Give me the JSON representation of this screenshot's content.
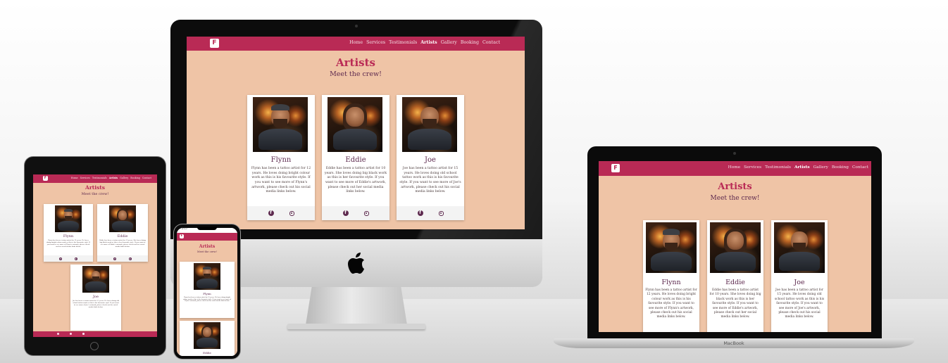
{
  "site": {
    "logo": "F",
    "nav": [
      {
        "label": "Home",
        "active": false
      },
      {
        "label": "Services",
        "active": false
      },
      {
        "label": "Testimonials",
        "active": false
      },
      {
        "label": "Artists",
        "active": true
      },
      {
        "label": "Gallery",
        "active": false
      },
      {
        "label": "Booking",
        "active": false
      },
      {
        "label": "Contact",
        "active": false
      }
    ],
    "title": "Artists",
    "subtitle": "Meet the crew!",
    "artists": [
      {
        "name": "Flynn",
        "desc": "Flynn has been a tattoo artist for 12 years. He loves doing bright colour work as this is his favourite style. If you want to see more of Flynn's artwork, please check out his social media links below."
      },
      {
        "name": "Eddie",
        "desc": "Eddie has been a tattoo artist for 10 years. She loves doing big black work as this is her favourite style. If you want to see more of Eddie's artwork, please check out her social media links below."
      },
      {
        "name": "Joe",
        "desc": "Joe has been a tattoo artist for 15 years. He loves doing old school tattoo work as this is his favourite style. If you want to see more of Joe's artwork, please check out his social media links below."
      }
    ],
    "colors": {
      "accent": "#b92a55",
      "background": "#efc4a6",
      "heading": "#5e2a4f"
    }
  },
  "devices": {
    "laptop_label": "MacBook",
    "phone_time": "2:17"
  }
}
